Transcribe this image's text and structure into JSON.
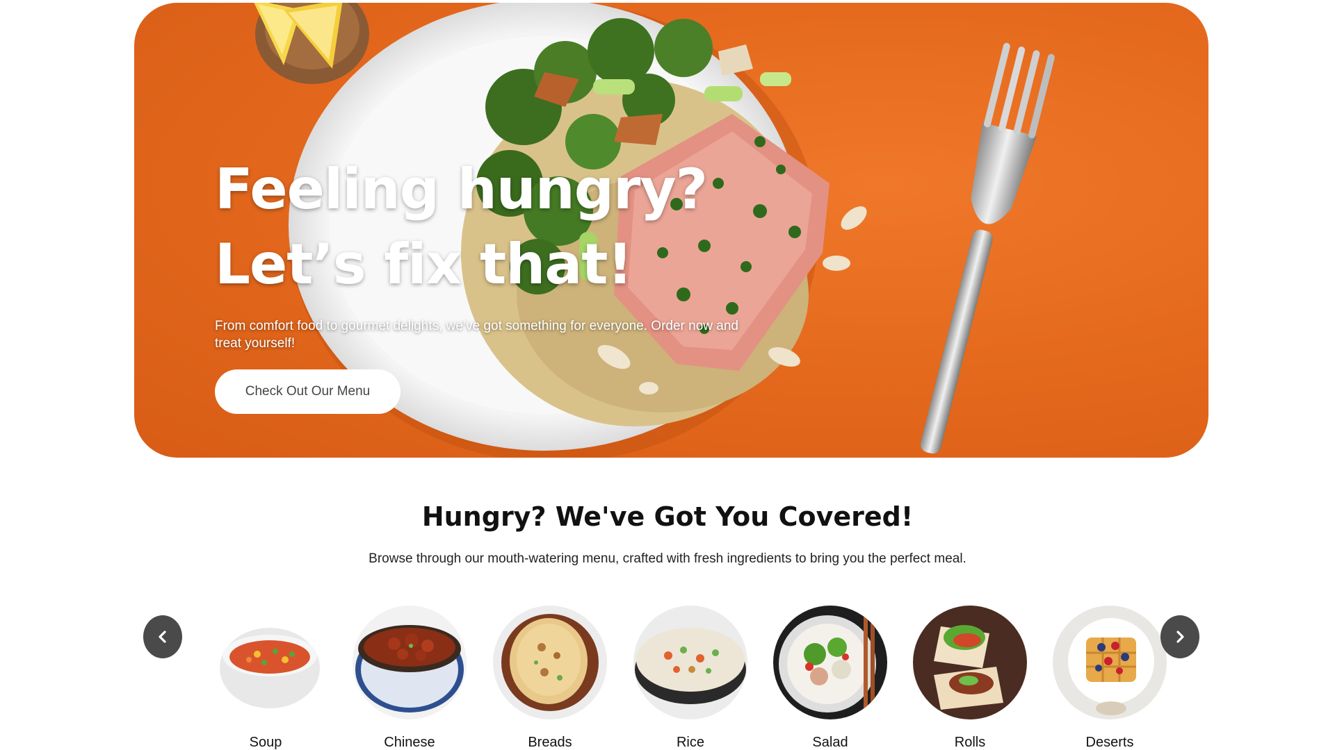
{
  "hero": {
    "title_line1": "Feeling hungry?",
    "title_line2": "Let’s fix that!",
    "subtitle": "From comfort food to gourmet delights, we’ve got something for everyone. Order now and treat yourself!",
    "cta_label": "Check Out Our Menu",
    "bg_color": "#e56a1e"
  },
  "section": {
    "title": "Hungry? We've Got You Covered!",
    "subtitle": "Browse through our mouth-watering menu, crafted with fresh ingredients to bring you the perfect meal."
  },
  "carousel": {
    "prev_icon": "chevron-left-icon",
    "next_icon": "chevron-right-icon",
    "categories": [
      {
        "label": "Soup"
      },
      {
        "label": "Chinese"
      },
      {
        "label": "Breads"
      },
      {
        "label": "Rice"
      },
      {
        "label": "Salad"
      },
      {
        "label": "Rolls"
      },
      {
        "label": "Deserts"
      }
    ]
  }
}
